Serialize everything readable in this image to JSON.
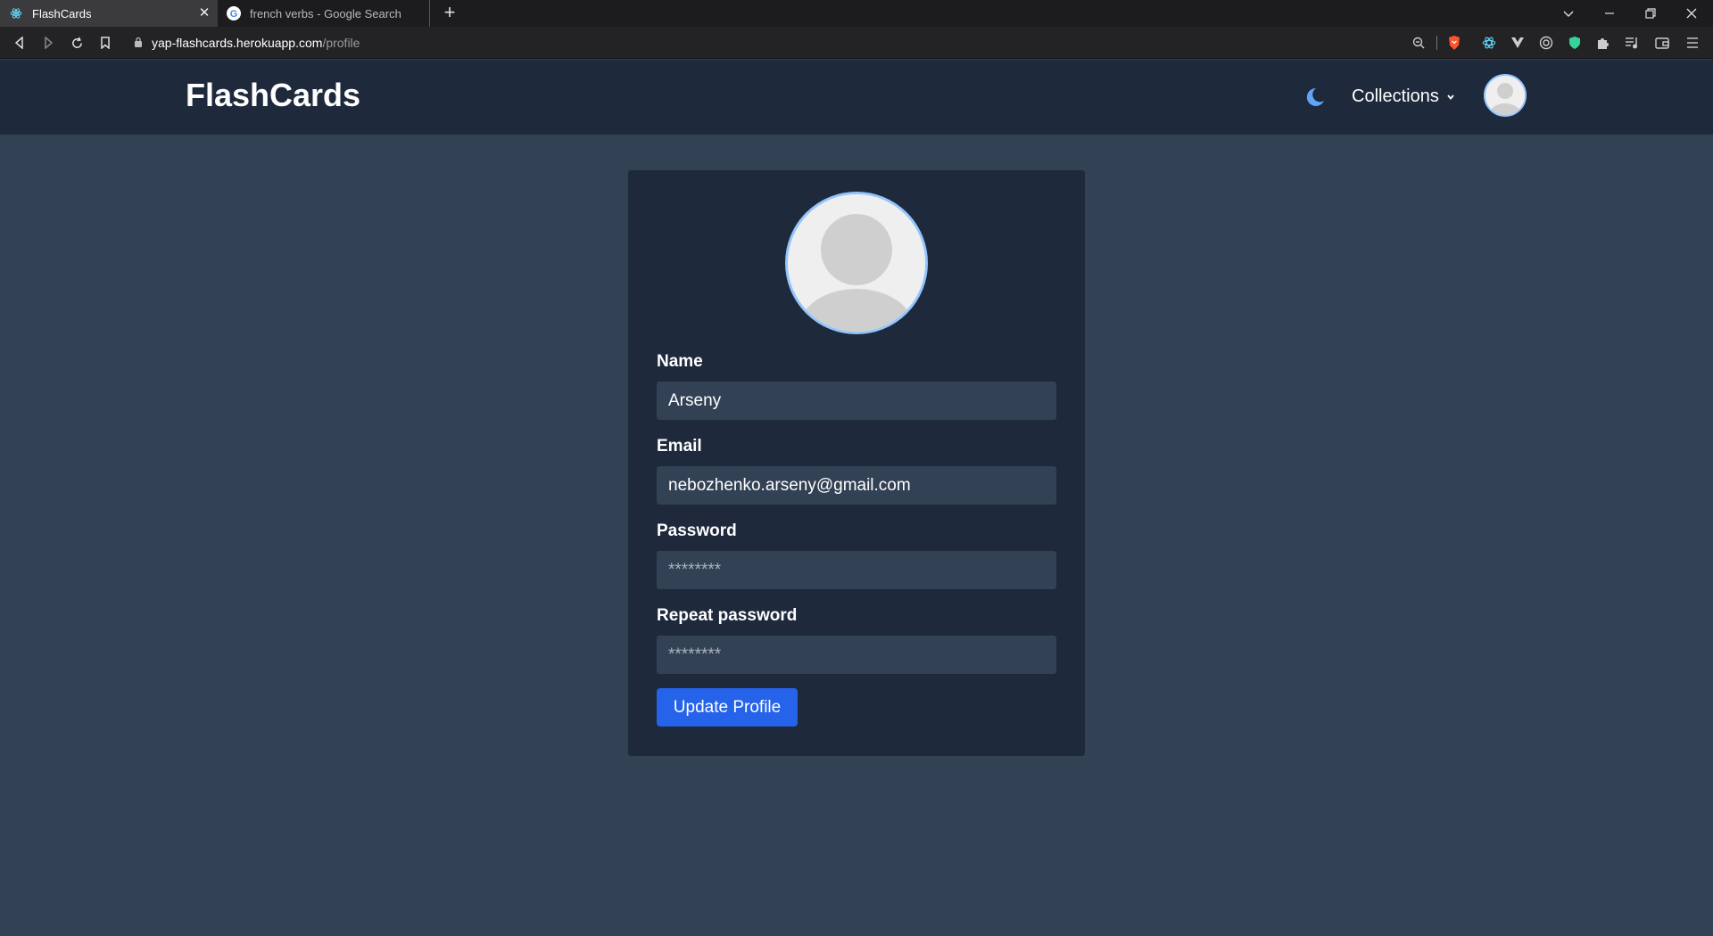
{
  "browser": {
    "tabs": [
      {
        "title": "FlashCards",
        "icon": "react-icon",
        "active": true
      },
      {
        "title": "french verbs - Google Search",
        "icon": "google-icon",
        "active": false
      }
    ],
    "url": {
      "host": "yap-flashcards.herokuapp.com",
      "path": "/profile"
    }
  },
  "header": {
    "brand": "FlashCards",
    "theme_icon": "moon-icon",
    "nav": {
      "collections_label": "Collections"
    }
  },
  "profile_form": {
    "name": {
      "label": "Name",
      "value": "Arseny"
    },
    "email": {
      "label": "Email",
      "value": "nebozhenko.arseny@gmail.com"
    },
    "password": {
      "label": "Password",
      "placeholder": "********"
    },
    "repeat_password": {
      "label": "Repeat password",
      "placeholder": "********"
    },
    "submit_label": "Update Profile"
  },
  "colors": {
    "page_bg": "#334155",
    "header_bg": "#1e293b",
    "card_bg": "#1e293b",
    "input_bg": "#334155",
    "primary": "#2563eb",
    "avatar_ring": "#93c5fd",
    "theme_icon": "#60a5fa"
  }
}
